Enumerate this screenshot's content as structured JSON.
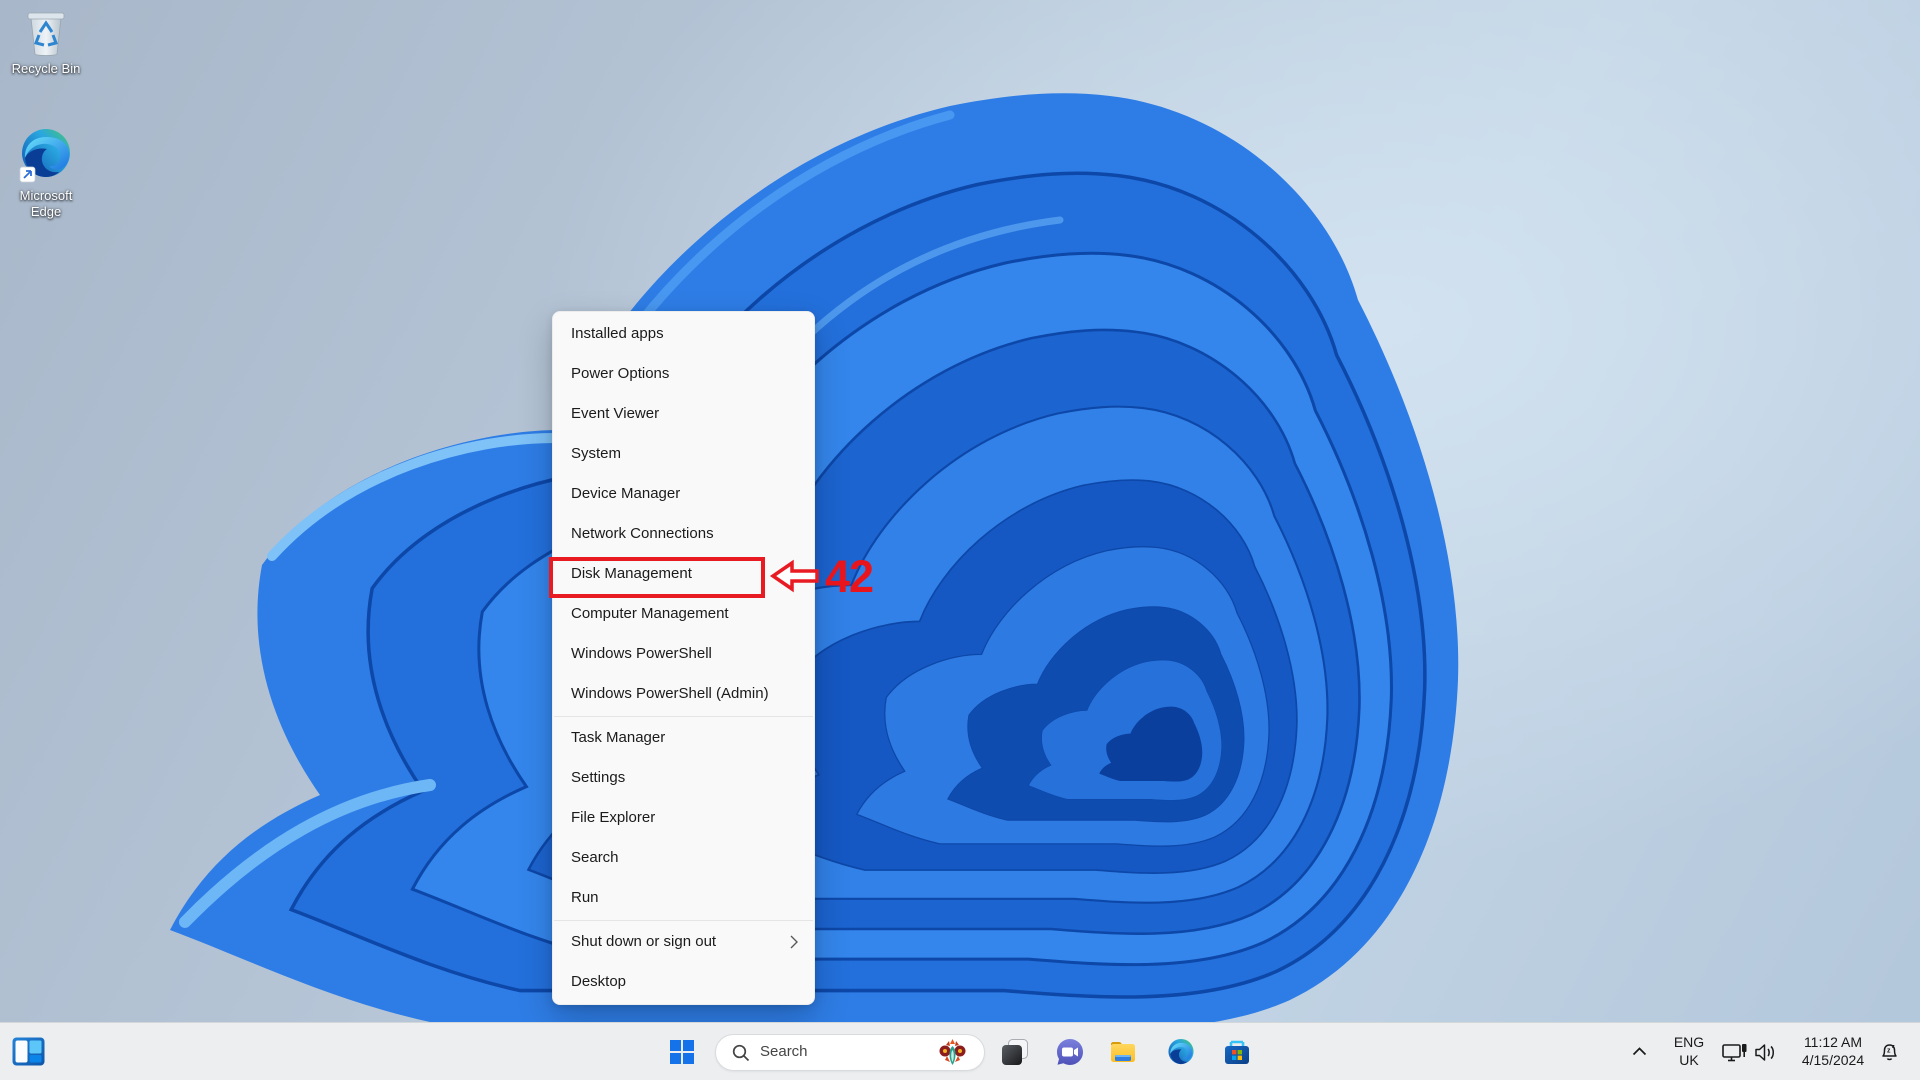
{
  "desktop": {
    "icons": [
      {
        "name": "recycle-bin",
        "label": "Recycle Bin"
      },
      {
        "name": "microsoft-edge",
        "line1": "Microsoft",
        "line2": "Edge"
      }
    ]
  },
  "context_menu": {
    "items": [
      {
        "label": "Installed apps"
      },
      {
        "label": "Power Options"
      },
      {
        "label": "Event Viewer"
      },
      {
        "label": "System"
      },
      {
        "label": "Device Manager"
      },
      {
        "label": "Network Connections"
      },
      {
        "label": "Disk Management"
      },
      {
        "label": "Computer Management"
      },
      {
        "label": "Windows PowerShell"
      },
      {
        "label": "Windows PowerShell (Admin)"
      },
      {
        "label": "Task Manager"
      },
      {
        "label": "Settings"
      },
      {
        "label": "File Explorer"
      },
      {
        "label": "Search"
      },
      {
        "label": "Run"
      },
      {
        "label": "Shut down or sign out",
        "has_submenu": true
      },
      {
        "label": "Desktop"
      }
    ],
    "highlighted_item": "Disk Management"
  },
  "annotation": {
    "number": "42",
    "shape": "left-block-arrow",
    "color": "#e8161c",
    "points_to": "Disk Management"
  },
  "taskbar": {
    "search": {
      "placeholder": "Search"
    },
    "tray": {
      "language": {
        "line1": "ENG",
        "line2": "UK"
      },
      "clock": {
        "time": "11:12 AM",
        "date": "4/15/2024"
      }
    }
  }
}
